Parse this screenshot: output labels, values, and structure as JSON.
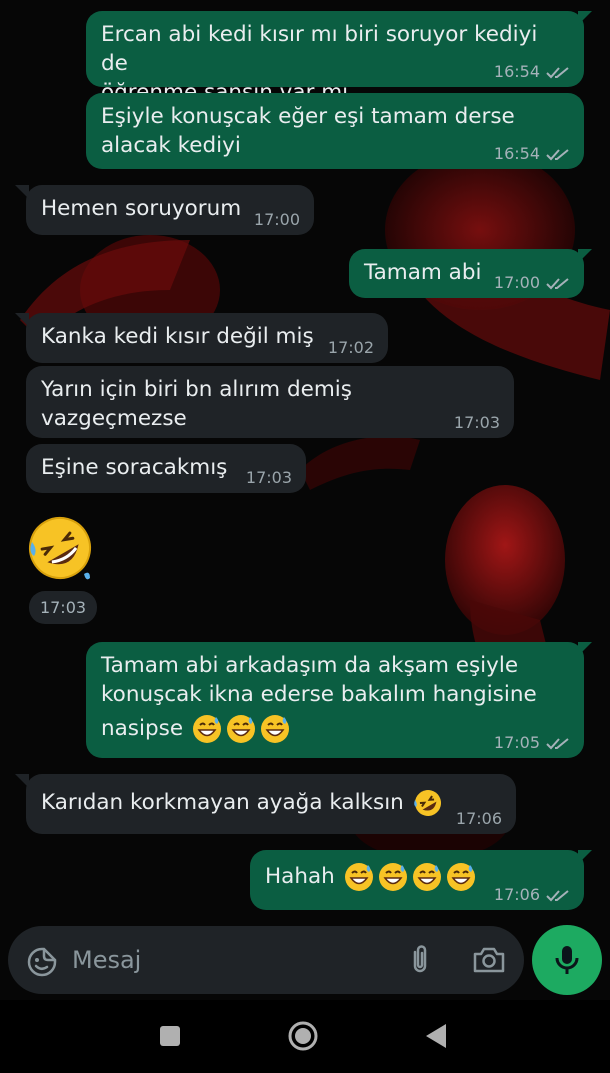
{
  "messages": [
    {
      "dir": "out",
      "text_lines": [
        "Ercan abi kedi kısır mı biri soruyor kediyi de",
        "öğrenme şansın var mı"
      ],
      "time": "16:54",
      "read": true
    },
    {
      "dir": "out",
      "text_lines": [
        "Eşiyle konuşcak eğer eşi tamam derse",
        "alacak kediyi"
      ],
      "time": "16:54",
      "read": true
    },
    {
      "dir": "in",
      "text": "Hemen soruyorum",
      "time": "17:00"
    },
    {
      "dir": "out",
      "text": "Tamam abi",
      "time": "17:00",
      "read": true
    },
    {
      "dir": "in",
      "text": "Kanka kedi kısır değil miş",
      "time": "17:02"
    },
    {
      "dir": "in",
      "text": "Yarın için biri bn alırım demiş vazgeçmezse",
      "time": "17:03"
    },
    {
      "dir": "in",
      "text": "Eşine soracakmış",
      "time": "17:03"
    },
    {
      "dir": "in",
      "sticker": "rolling-on-floor-laughing-emoji",
      "time": "17:03"
    },
    {
      "dir": "out",
      "text_lines": [
        "Tamam abi arkadaşım da akşam eşiyle",
        "konuşcak ikna ederse bakalım hangisine",
        "nasipse"
      ],
      "emoji": [
        "grinning-sweat-emoji",
        "grinning-sweat-emoji",
        "grinning-sweat-emoji"
      ],
      "time": "17:05",
      "read": true
    },
    {
      "dir": "in",
      "text": "Karıdan korkmayan ayağa kalksın",
      "emoji": [
        "rolling-on-floor-laughing-emoji"
      ],
      "time": "17:06"
    },
    {
      "dir": "out",
      "text": "Hahah",
      "emoji": [
        "grinning-sweat-emoji",
        "grinning-sweat-emoji",
        "grinning-sweat-emoji",
        "grinning-sweat-emoji"
      ],
      "time": "17:06",
      "read": true
    }
  ],
  "composer": {
    "placeholder": "Mesaj",
    "icons": [
      "sticker-icon",
      "attach-paperclip-icon",
      "camera-icon"
    ]
  },
  "send_button": {
    "icon": "microphone-icon"
  },
  "navbar": {
    "icons": [
      "recents-square-icon",
      "home-circle-icon",
      "back-triangle-icon"
    ]
  },
  "colors": {
    "outgoing_bubble": "#0b5e42",
    "incoming_bubble": "#1f2327",
    "background": "#060606",
    "accent_green": "#1daa61",
    "read_ticks": "#a5b2b9"
  }
}
